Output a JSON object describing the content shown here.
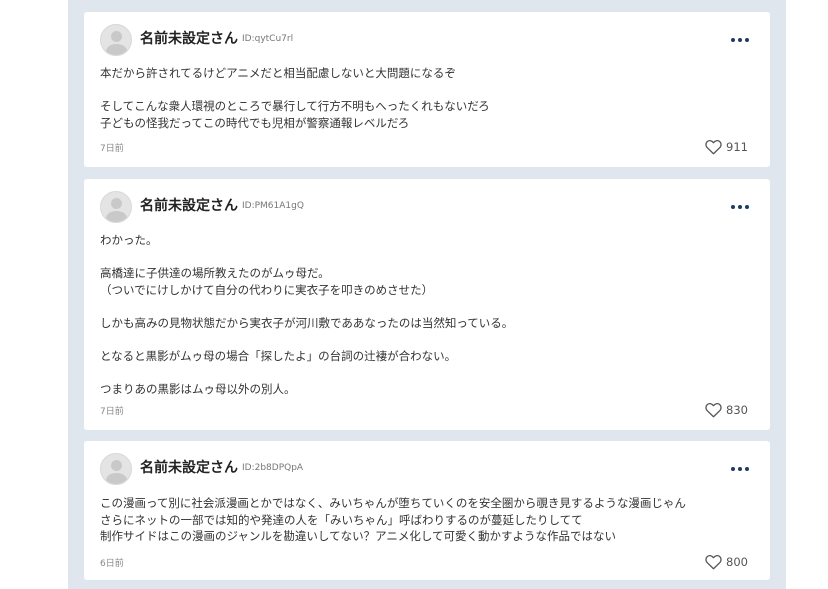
{
  "comments": [
    {
      "user_name": "名前未設定さん",
      "user_id": "ID:qytCu7rl",
      "body": "本だから許されてるけどアニメだと相当配慮しないと大問題になるぞ\n\nそしてこんな衆人環視のところで暴行して行方不明もへったくれもないだろ\n子どもの怪我だってこの時代でも児相が警察通報レベルだろ",
      "time": "7日前",
      "likes": "911"
    },
    {
      "user_name": "名前未設定さん",
      "user_id": "ID:PM61A1gQ",
      "body": "わかった。\n\n高橋達に子供達の場所教えたのがムゥ母だ。\n（ついでにけしかけて自分の代わりに実衣子を叩きのめさせた）\n\nしかも高みの見物状態だから実衣子が河川敷でああなったのは当然知っている。\n\nとなると黒影がムゥ母の場合「探したよ」の台詞の辻褄が合わない。\n\nつまりあの黒影はムゥ母以外の別人。",
      "time": "7日前",
      "likes": "830"
    },
    {
      "user_name": "名前未設定さん",
      "user_id": "ID:2b8DPQpA",
      "body": "この漫画って別に社会派漫画とかではなく、みいちゃんが堕ちていくのを安全圏から覗き見するような漫画じゃん\nさらにネットの一部では知的や発達の人を「みいちゃん」呼ばわりするのが蔓延したりしてて\n制作サイドはこの漫画のジャンルを勘違いしてない？アニメ化して可愛く動かすような作品ではない",
      "time": "6日前",
      "likes": "800"
    }
  ],
  "icons": {
    "avatar": "default-user-avatar",
    "menu": "more-dots-icon",
    "like": "heart-outline-icon"
  },
  "colors": {
    "page_background": "#dfe6ee",
    "card_background": "#ffffff",
    "menu_dots": "#1f3b63"
  }
}
